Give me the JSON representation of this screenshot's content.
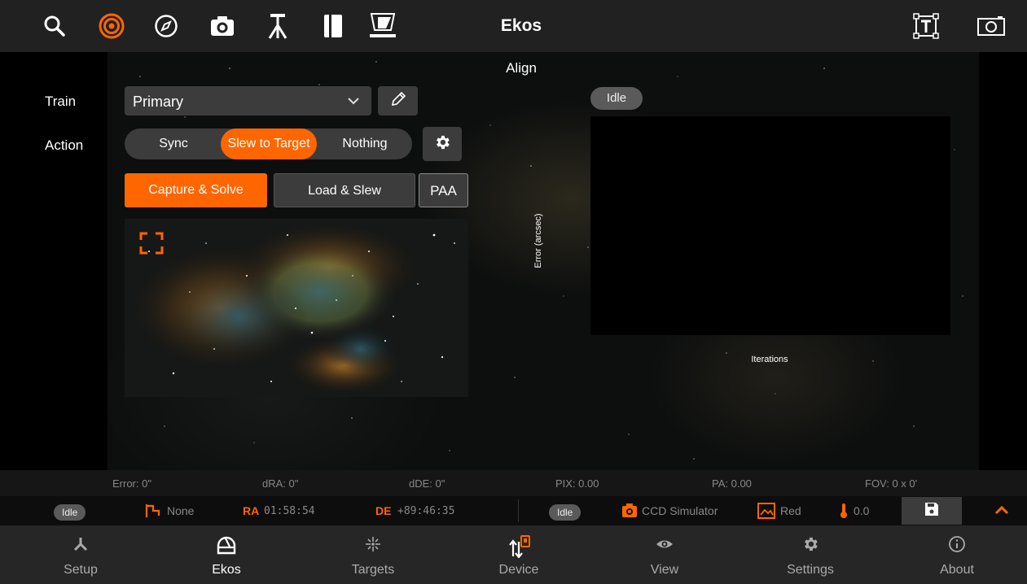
{
  "app": {
    "title": "Ekos",
    "toolbar_icons": [
      "search-icon",
      "target-icon",
      "compass-icon",
      "camera-icon",
      "tripod-icon",
      "book-icon",
      "telescope-icon"
    ],
    "toolbar_right_icons": [
      "text-frame-icon",
      "screenshot-icon"
    ]
  },
  "align": {
    "section_title": "Align",
    "train_label": "Train",
    "train_value": "Primary",
    "action_label": "Action",
    "actions": [
      "Sync",
      "Slew to Target",
      "Nothing"
    ],
    "active_action": "Slew to Target",
    "capture_solve": "Capture & Solve",
    "load_slew": "Load & Slew",
    "paa": "PAA",
    "status": "Idle",
    "chart_ylabel": "Error (arcsec)",
    "chart_xlabel": "Iterations"
  },
  "stats": {
    "error": "Error: 0\"",
    "dra": "dRA: 0\"",
    "dde": "dDE: 0\"",
    "pix": "PIX: 0.00",
    "pa": "PA: 0.00",
    "fov": "FOV: 0 x 0'"
  },
  "statusbar": {
    "mount_status": "Idle",
    "pier": "None",
    "ra_label": "RA",
    "ra_value": "01:58:54",
    "de_label": "DE",
    "de_value": "+89:46:35",
    "camera_status": "Idle",
    "camera": "CCD Simulator",
    "filter": "Red",
    "temperature": "0.0"
  },
  "nav": {
    "items": [
      {
        "label": "Setup"
      },
      {
        "label": "Ekos"
      },
      {
        "label": "Targets"
      },
      {
        "label": "Device"
      },
      {
        "label": "View"
      },
      {
        "label": "Settings"
      },
      {
        "label": "About"
      }
    ],
    "active": "Ekos"
  },
  "colors": {
    "accent": "#ff6600",
    "toolbar_bg": "#212121",
    "control_bg": "#3c3c3c"
  }
}
